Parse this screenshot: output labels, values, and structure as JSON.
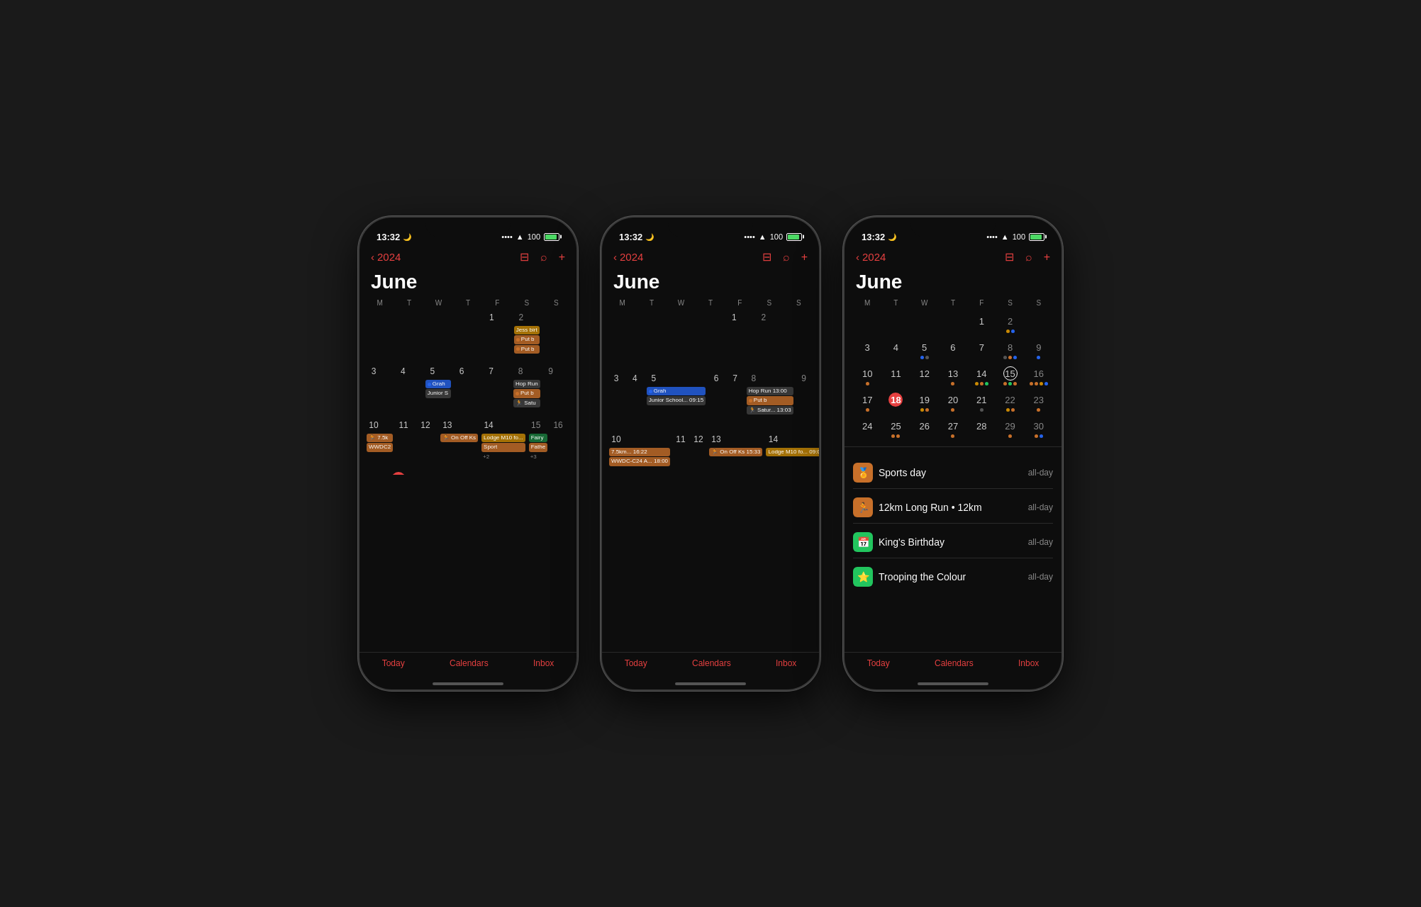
{
  "phones": [
    {
      "id": "phone1",
      "status": {
        "time": "13:32",
        "moon": true,
        "wifi": true,
        "battery": "100"
      },
      "nav": {
        "year": "2024",
        "back_icon": "‹",
        "layout_icon": "≡",
        "search_icon": "⌕",
        "add_icon": "+"
      },
      "month": "June",
      "day_headers": [
        "M",
        "T",
        "W",
        "T",
        "F",
        "S",
        "S"
      ],
      "view": "month_compact",
      "tabs": [
        "Today",
        "Calendars",
        "Inbox"
      ]
    },
    {
      "id": "phone2",
      "status": {
        "time": "13:32",
        "moon": true,
        "wifi": true,
        "battery": "100"
      },
      "nav": {
        "year": "2024",
        "back_icon": "‹",
        "layout_icon": "≡",
        "search_icon": "⌕",
        "add_icon": "+"
      },
      "month": "June",
      "day_headers": [
        "M",
        "T",
        "W",
        "T",
        "F",
        "S",
        "S"
      ],
      "view": "month_expanded",
      "tabs": [
        "Today",
        "Calendars",
        "Inbox"
      ]
    },
    {
      "id": "phone3",
      "status": {
        "time": "13:32",
        "moon": true,
        "wifi": true,
        "battery": "100"
      },
      "nav": {
        "year": "2024",
        "back_icon": "‹",
        "layout_icon": "≡",
        "search_icon": "⌕",
        "add_icon": "+"
      },
      "month": "June",
      "day_headers": [
        "M",
        "T",
        "W",
        "T",
        "F",
        "S",
        "S"
      ],
      "view": "month_dots",
      "selected_day": "15",
      "events": [
        {
          "icon": "🏅",
          "icon_bg": "#c8702a",
          "name": "Sports day",
          "time": "all-day"
        },
        {
          "icon": "🏃",
          "icon_bg": "#c8702a",
          "name": "12km Long Run • 12km",
          "time": "all-day"
        },
        {
          "icon": "📅",
          "icon_bg": "#22c55e",
          "name": "King's Birthday",
          "time": "all-day"
        },
        {
          "icon": "⭐",
          "icon_bg": "#22c55e",
          "name": "Trooping the Colour",
          "time": "all-day"
        }
      ],
      "tabs": [
        "Today",
        "Calendars",
        "Inbox"
      ]
    }
  ]
}
